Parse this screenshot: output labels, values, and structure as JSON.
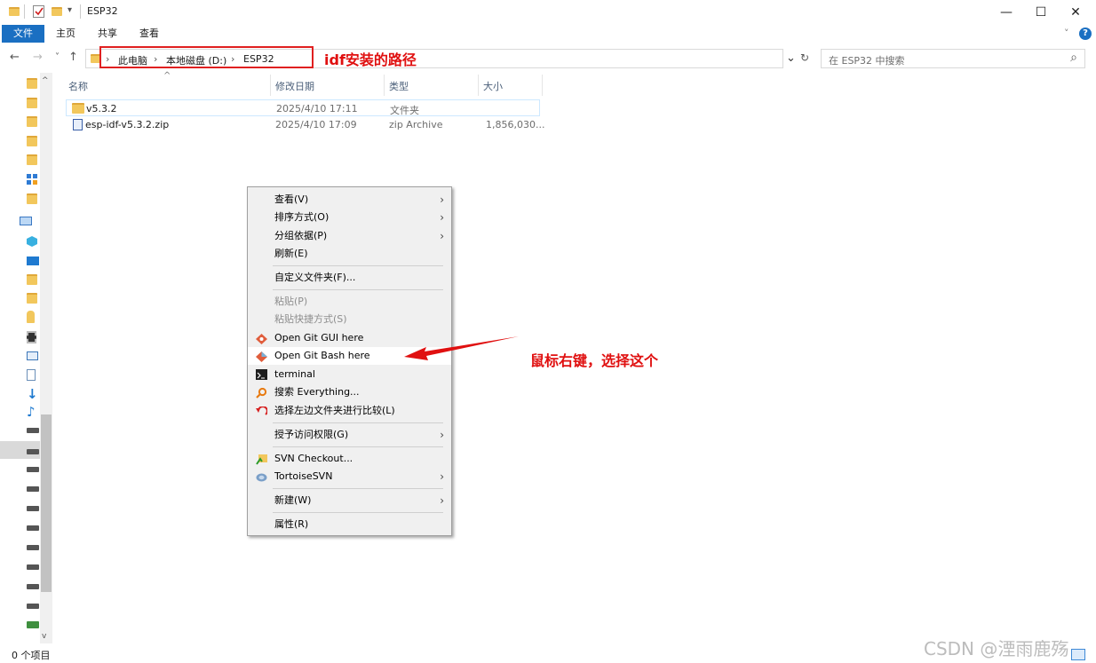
{
  "window": {
    "title": "ESP32",
    "minimize": "—",
    "maximize": "☐",
    "close": "✕"
  },
  "ribbon": {
    "file": "文件",
    "home": "主页",
    "share": "共享",
    "view": "查看",
    "help": "?"
  },
  "address": {
    "back": "←",
    "forward": "→",
    "recent": "˅",
    "up": "↑",
    "crumbs": [
      "此电脑",
      "本地磁盘 (D:)",
      "ESP32"
    ],
    "separator": "›",
    "dropdown": "⌄",
    "refresh": "↻"
  },
  "search": {
    "placeholder": "在 ESP32 中搜索",
    "icon": "⌕"
  },
  "annotations": {
    "path_label": "idf安装的路径",
    "right_click": "鼠标右键，选择这个"
  },
  "columns": {
    "name": "名称",
    "date": "修改日期",
    "type": "类型",
    "size": "大小",
    "sort_indicator": "^"
  },
  "files": [
    {
      "name": "v5.3.2",
      "date": "2025/4/10 17:11",
      "type": "文件夹",
      "size": ""
    },
    {
      "name": "esp-idf-v5.3.2.zip",
      "date": "2025/4/10 17:09",
      "type": "zip Archive",
      "size": "1,856,030..."
    }
  ],
  "context_menu": [
    {
      "label": "查看(V)",
      "submenu": true
    },
    {
      "label": "排序方式(O)",
      "submenu": true
    },
    {
      "label": "分组依据(P)",
      "submenu": true
    },
    {
      "label": "刷新(E)"
    },
    {
      "label": "自定义文件夹(F)..."
    },
    {
      "label": "粘贴(P)",
      "disabled": true
    },
    {
      "label": "粘贴快捷方式(S)",
      "disabled": true
    },
    {
      "label": "Open Git GUI here",
      "icon": "git-icon"
    },
    {
      "label": "Open Git Bash here",
      "icon": "git-icon",
      "highlight": true
    },
    {
      "label": "terminal",
      "icon": "terminal-icon"
    },
    {
      "label": "搜索 Everything...",
      "icon": "everything-search-icon"
    },
    {
      "label": "选择左边文件夹进行比较(L)",
      "icon": "compare-icon"
    },
    {
      "label": "授予访问权限(G)",
      "submenu": true
    },
    {
      "label": "SVN Checkout...",
      "icon": "svn-checkout-icon"
    },
    {
      "label": "TortoiseSVN",
      "icon": "tortoisesvn-icon",
      "submenu": true
    },
    {
      "label": "新建(W)",
      "submenu": true
    },
    {
      "label": "属性(R)"
    }
  ],
  "submenu_arrow": "›",
  "status": {
    "count": "0 个项目"
  },
  "watermark": "CSDN @湮雨鹿殇",
  "colors": {
    "accent": "#1a6fc2",
    "annotation": "#e01010",
    "folder": "#f2c75c"
  }
}
